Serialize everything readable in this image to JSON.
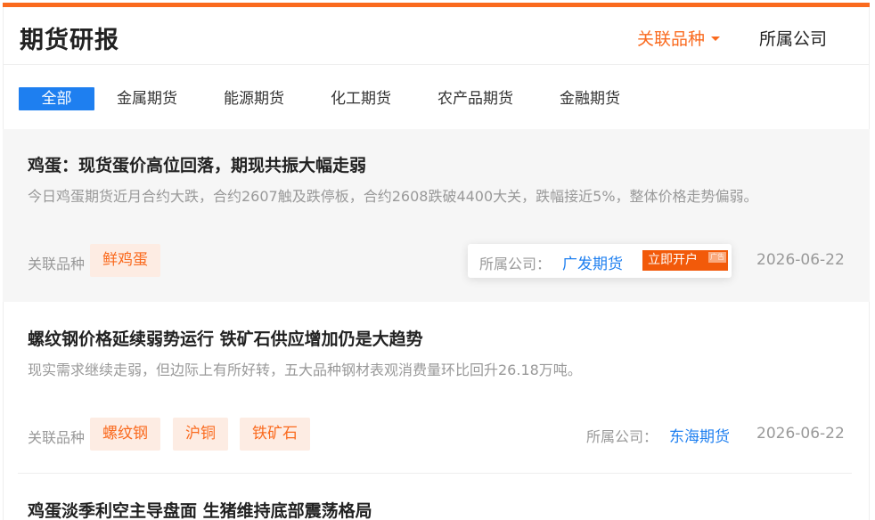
{
  "header": {
    "title": "期货研报",
    "filter_variety": "关联品种",
    "filter_company": "所属公司"
  },
  "tabs": [
    "全部",
    "金属期货",
    "能源期货",
    "化工期货",
    "农产品期货",
    "金融期货"
  ],
  "articles": [
    {
      "title": "鸡蛋：现货蛋价高位回落，期现共振大幅走弱",
      "desc": "今日鸡蛋期货近月合约大跌，合约2607触及跌停板，合约2608跌破4400大关，跌幅接近5%，整体价格走势偏弱。",
      "varieties_label": "关联品种",
      "tags": [
        "鲜鸡蛋"
      ],
      "company_label": "所属公司：",
      "company": "广发期货",
      "open_account": "立即开户",
      "ad": "广告",
      "date": "2026-06-22"
    },
    {
      "title": "螺纹钢价格延续弱势运行 铁矿石供应增加仍是大趋势",
      "desc": "现实需求继续走弱，但边际上有所好转，五大品种钢材表观消费量环比回升26.18万吨。",
      "varieties_label": "关联品种",
      "tags": [
        "螺纹钢",
        "沪铜",
        "铁矿石"
      ],
      "company_label": "所属公司：",
      "company": "东海期货",
      "date": "2026-06-22"
    },
    {
      "title": "鸡蛋淡季利空主导盘面 生猪维持底部震荡格局"
    }
  ],
  "colors": {
    "accent": "#fa6a1e",
    "link": "#1e7ff0",
    "tag_bg": "#fdece3",
    "hover_bg": "#f6f6f6"
  }
}
